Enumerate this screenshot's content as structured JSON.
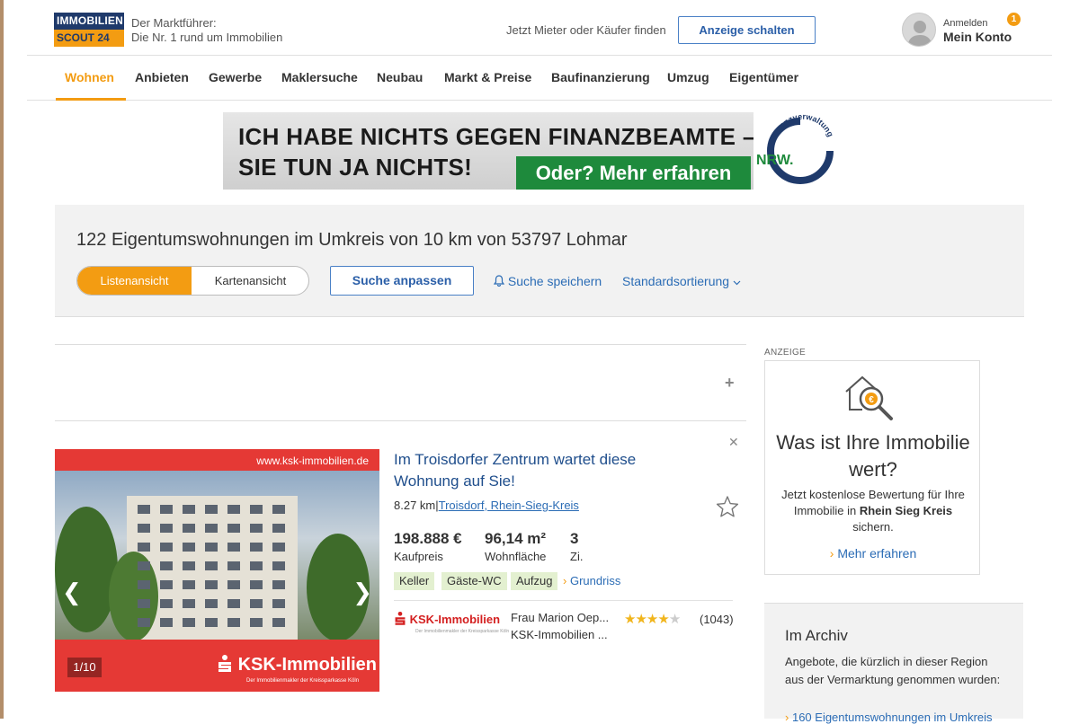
{
  "header": {
    "logo_line1": "IMMOBILIEN",
    "logo_line2": "SCOUT 24",
    "tagline_1": "Der Marktführer:",
    "tagline_2": "Die Nr. 1 rund um Immobilien",
    "find_text": "Jetzt Mieter oder Käufer finden",
    "cta_label": "Anzeige schalten",
    "account_small": "Anmelden",
    "account_big": "Mein Konto",
    "notification_count": "1"
  },
  "nav": {
    "items": [
      "Wohnen",
      "Anbieten",
      "Gewerbe",
      "Maklersuche",
      "Neubau",
      "Markt & Preise",
      "Baufinanzierung",
      "Umzug",
      "Eigentümer"
    ],
    "active": "Wohnen"
  },
  "banner": {
    "line1": "ICH HABE NICHTS GEGEN FINANZBEAMTE –",
    "line2": "SIE TUN JA NICHTS!",
    "cta": "Oder? Mehr erfahren",
    "logo_text": "NRW.",
    "logo_ring": "Finanzverwaltung"
  },
  "search": {
    "count": "122",
    "title_rest": "Eigentumswohnungen im Umkreis von 10 km von 53797 Lohmar",
    "view_list": "Listenansicht",
    "view_map": "Kartenansicht",
    "adjust_label": "Suche anpassen",
    "save_label": "Suche speichern",
    "sort_label": "Standardsortierung"
  },
  "listing": {
    "image_url": "www.ksk-immobilien.de",
    "image_brand": "KSK-Immobilien",
    "image_brand_sub": "Der Immobilienmakler der Kreissparkasse Köln",
    "image_counter": "1/10",
    "title": "Im Troisdorfer Zentrum wartet diese Wohnung auf Sie!",
    "distance": "8.27 km",
    "location": "Troisdorf, Rhein-Sieg-Kreis",
    "price": "198.888 €",
    "price_label": "Kaufpreis",
    "area": "96,14 m²",
    "area_label": "Wohnfläche",
    "rooms": "3",
    "rooms_label": "Zi.",
    "tags": [
      "Keller",
      "Gäste-WC",
      "Aufzug"
    ],
    "floorplan_label": "Grundriss",
    "agent_logo": "KSK-Immobilien",
    "agent_name": "Frau Marion Oep...",
    "agent_company": "KSK-Immobilien ...",
    "rating": 4,
    "rating_count": "(1043)"
  },
  "ad": {
    "label": "ANZEIGE",
    "title": "Was ist Ihre Immobilie wert?",
    "text_1": "Jetzt kostenlose Bewertung für Ihre Immobilie in ",
    "text_bold": "Rhein Sieg Kreis",
    "text_2": " sichern.",
    "link": "Mehr erfahren"
  },
  "archive": {
    "title": "Im Archiv",
    "text": "Angebote, die kürzlich in dieser Region aus der Vermarktung genommen wurden:",
    "link": "160 Eigentumswohnungen im Umkreis"
  },
  "colors": {
    "accent": "#f39c12",
    "link": "#2b6cb5",
    "brand_navy": "#1f3a6b",
    "ksk_red": "#e53935",
    "banner_green": "#1e8a3c"
  }
}
